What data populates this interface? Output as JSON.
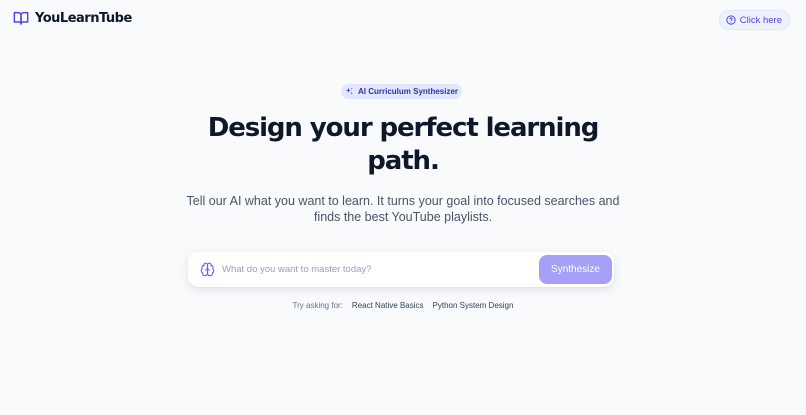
{
  "header": {
    "brand_name": "YouLearnTube",
    "brand_icon": "open-book-icon",
    "help_label": "Click here",
    "help_icon": "question-circle-icon"
  },
  "hero": {
    "badge_label": "AI Curriculum Synthesizer",
    "badge_icon": "sparkles-icon",
    "title_line1": "Design your perfect learning",
    "title_line2": "path.",
    "subtitle": "Tell our AI what you want to learn. It turns your goal into focused searches and finds the best YouTube playlists."
  },
  "search": {
    "icon": "brain-icon",
    "placeholder": "What do you want to master today?",
    "value": "",
    "submit_label": "Synthesize"
  },
  "suggestions": {
    "label": "Try asking for:",
    "items": [
      "React Native Basics",
      "Python System Design"
    ]
  },
  "colors": {
    "accent": "#4f46e5",
    "accent_light": "#e0e7ff",
    "button": "#a5a0f5",
    "text_dark": "#0f172a",
    "text_muted": "#475569",
    "background": "#f8fafc"
  }
}
